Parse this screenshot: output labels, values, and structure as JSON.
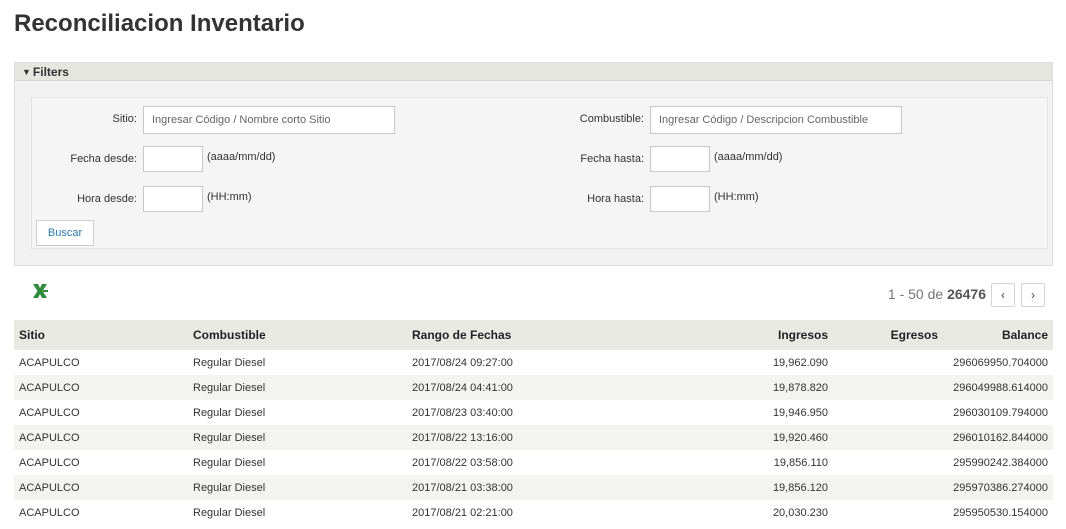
{
  "page": {
    "title": "Reconciliacion Inventario"
  },
  "filters": {
    "header": "Filters",
    "sitio": {
      "label": "Sitio:",
      "placeholder": "Ingresar Código / Nombre corto Sitio",
      "value": ""
    },
    "combustible": {
      "label": "Combustible:",
      "placeholder": "Ingresar Código / Descripcion Combustible",
      "value": ""
    },
    "fecha_desde": {
      "label": "Fecha desde:",
      "hint": "(aaaa/mm/dd)",
      "value": ""
    },
    "fecha_hasta": {
      "label": "Fecha hasta:",
      "hint": "(aaaa/mm/dd)",
      "value": ""
    },
    "hora_desde": {
      "label": "Hora desde:",
      "hint": "(HH:mm)",
      "value": ""
    },
    "hora_hasta": {
      "label": "Hora hasta:",
      "hint": "(HH:mm)",
      "value": ""
    },
    "search_button": "Buscar"
  },
  "toolbar": {
    "export_icon": "excel-export-icon",
    "export_color": "#2e8b3a"
  },
  "pager": {
    "range": "1 - 50",
    "of": "de",
    "total": "26476",
    "prev": "‹",
    "next": "›"
  },
  "table": {
    "columns": [
      "Sitio",
      "Combustible",
      "Rango de Fechas",
      "Ingresos",
      "Egresos",
      "Balance"
    ],
    "rows": [
      [
        "ACAPULCO",
        "Regular Diesel",
        "2017/08/24 09:27:00",
        "19,962.090",
        "",
        "296069950.704000"
      ],
      [
        "ACAPULCO",
        "Regular Diesel",
        "2017/08/24 04:41:00",
        "19,878.820",
        "",
        "296049988.614000"
      ],
      [
        "ACAPULCO",
        "Regular Diesel",
        "2017/08/23 03:40:00",
        "19,946.950",
        "",
        "296030109.794000"
      ],
      [
        "ACAPULCO",
        "Regular Diesel",
        "2017/08/22 13:16:00",
        "19,920.460",
        "",
        "296010162.844000"
      ],
      [
        "ACAPULCO",
        "Regular Diesel",
        "2017/08/22 03:58:00",
        "19,856.110",
        "",
        "295990242.384000"
      ],
      [
        "ACAPULCO",
        "Regular Diesel",
        "2017/08/21 03:38:00",
        "19,856.120",
        "",
        "295970386.274000"
      ],
      [
        "ACAPULCO",
        "Regular Diesel",
        "2017/08/21 02:21:00",
        "20,030.230",
        "",
        "295950530.154000"
      ]
    ]
  }
}
